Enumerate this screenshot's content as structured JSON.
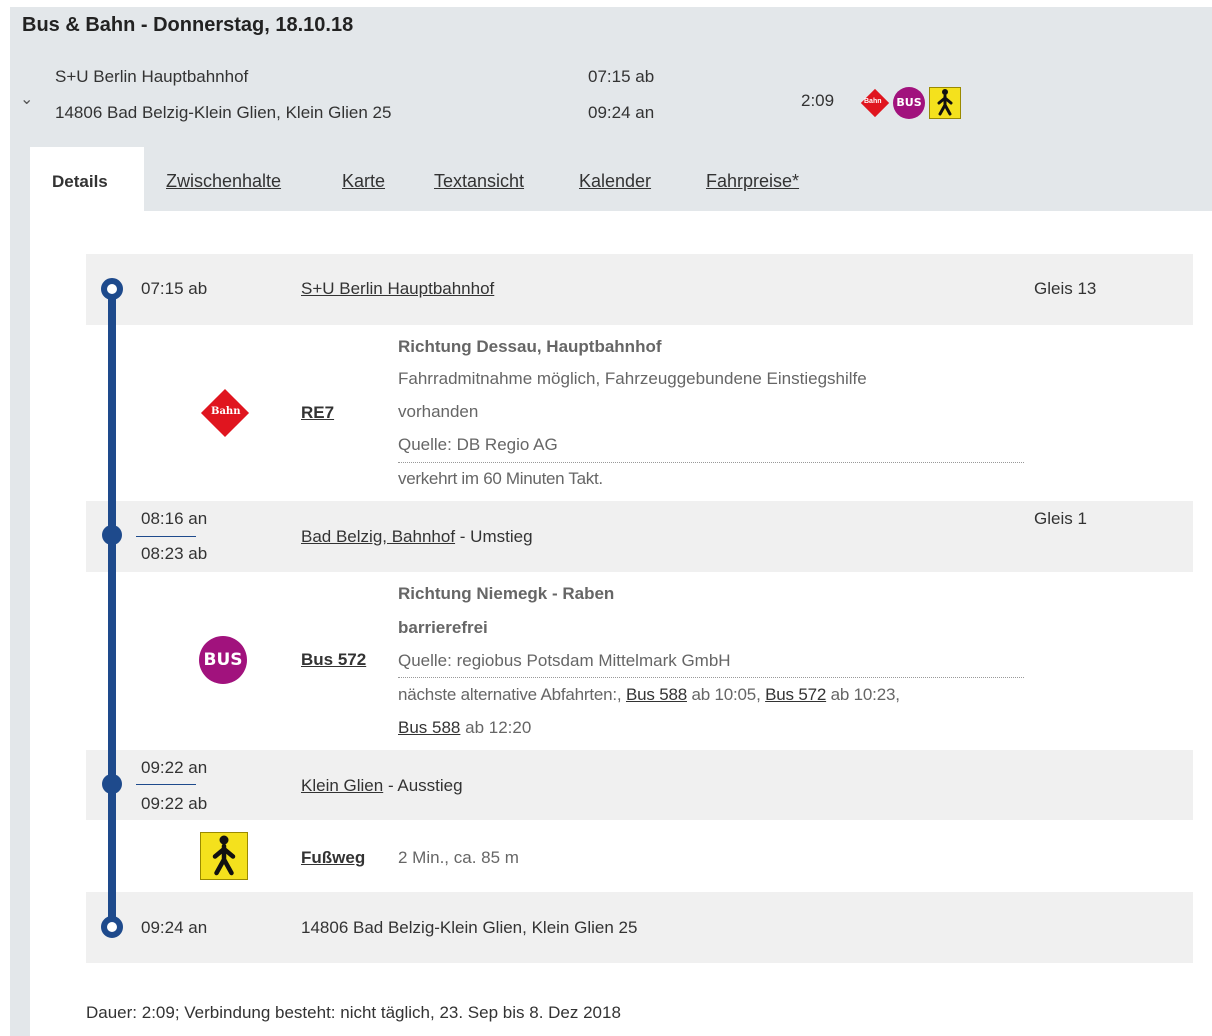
{
  "header": {
    "title": "Bus & Bahn - Donnerstag, 18.10.18"
  },
  "summary": {
    "from": "S+U Berlin Hauptbahnhof",
    "to": "14806 Bad Belzig-Klein Glien, Klein Glien 25",
    "dep": "07:15 ab",
    "arr": "09:24 an",
    "duration": "2:09",
    "icon_names": [
      "bahn-icon",
      "bus-icon",
      "walk-icon"
    ],
    "bahn_label": "Bahn",
    "bus_label": "BUS"
  },
  "tabs": [
    "Details",
    "Zwischenhalte",
    "Karte",
    "Textansicht",
    "Kalender",
    "Fahrpreise*"
  ],
  "stop1": {
    "time": "07:15",
    "suffix": "ab",
    "station": "S+U Berlin Hauptbahnhof",
    "platform": "Gleis 13"
  },
  "leg1": {
    "line": "RE7",
    "icon_label": "Bahn",
    "direction": "Richtung Dessau, Hauptbahnhof",
    "info1": "Fahrradmitnahme möglich, Fahrzeuggebundene Einstiegshilfe",
    "info2": "vorhanden",
    "source": "Quelle: DB Regio AG",
    "note": "verkehrt im 60 Minuten Takt."
  },
  "stop2": {
    "arr_time": "08:16",
    "arr_suffix": "an",
    "dep_time": "08:23",
    "dep_suffix": "ab",
    "station": "Bad Belzig, Bahnhof",
    "type": " - Umstieg",
    "platform": "Gleis 1"
  },
  "leg2": {
    "line": "Bus 572",
    "icon_label": "BUS",
    "direction": "Richtung Niemegk - Raben",
    "access": "barrierefrei",
    "source": "Quelle: regiobus Potsdam Mittelmark GmbH",
    "alt_prefix": "nächste alternative Abfahrten:,",
    "alt1_line": "Bus 588",
    "alt1_time": " ab 10:05,",
    "alt2_line": "Bus 572",
    "alt2_time": " ab 10:23,",
    "alt3_line": "Bus 588",
    "alt3_time": " ab 12:20"
  },
  "stop3": {
    "arr_time": "09:22",
    "arr_suffix": "an",
    "dep_time": "09:22",
    "dep_suffix": "ab",
    "station": "Klein Glien",
    "type": " - Ausstieg"
  },
  "walk": {
    "label": "Fußweg",
    "info": "2 Min., ca. 85 m"
  },
  "stop4": {
    "time": "09:24",
    "suffix": "an",
    "station": "14806 Bad Belzig-Klein Glien, Klein Glien 25"
  },
  "footer": {
    "text": "Dauer: 2:09; Verbindung besteht: nicht täglich, 23. Sep bis 8. Dez 2018"
  },
  "colors": {
    "line_blue": "#1e4a8c",
    "bahn_red": "#e0151f",
    "bus_purple": "#a1127d",
    "walk_yellow": "#f4e11d"
  }
}
